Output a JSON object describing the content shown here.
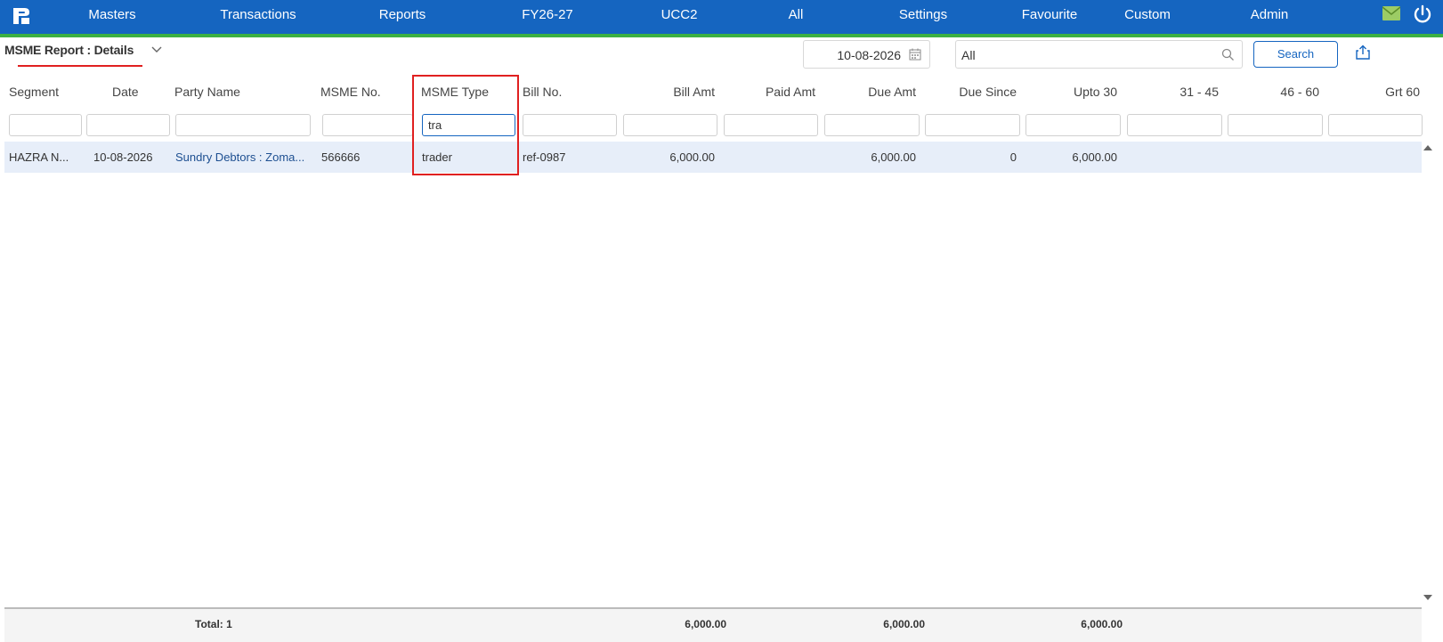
{
  "nav": {
    "items": [
      "Masters",
      "Transactions",
      "Reports",
      "FY26-27",
      "UCC2",
      "All",
      "Settings",
      "Favourite",
      "Custom",
      "Admin"
    ],
    "logo_icon": "logo-icon",
    "mail_icon": "mail-icon",
    "power_icon": "power-icon",
    "colors": {
      "bar": "#1565c0",
      "accent_line": "#3cb043"
    }
  },
  "report": {
    "title": "MSME Report : Details",
    "date": "10-08-2026",
    "search_value": "All",
    "search_button": "Search"
  },
  "columns": [
    "Segment",
    "Date",
    "Party Name",
    "MSME No.",
    "MSME Type",
    "Bill No.",
    "Bill Amt",
    "Paid Amt",
    "Due Amt",
    "Due Since",
    "Upto 30",
    "31 - 45",
    "46 - 60",
    "Grt 60"
  ],
  "filters": {
    "msme_type": "tra"
  },
  "rows": [
    {
      "segment": "HAZRA N...",
      "date": "10-08-2026",
      "party_name": "Sundry Debtors : Zoma...",
      "msme_no": "566666",
      "msme_type": "trader",
      "bill_no": "ref-0987",
      "bill_amt": "6,000.00",
      "paid_amt": "",
      "due_amt": "6,000.00",
      "due_since": "0",
      "upto_30": "6,000.00",
      "d31_45": "",
      "d46_60": "",
      "grt_60": ""
    }
  ],
  "footer": {
    "total_label": "Total: 1",
    "bill_amt": "6,000.00",
    "due_amt": "6,000.00",
    "upto_30": "6,000.00"
  }
}
